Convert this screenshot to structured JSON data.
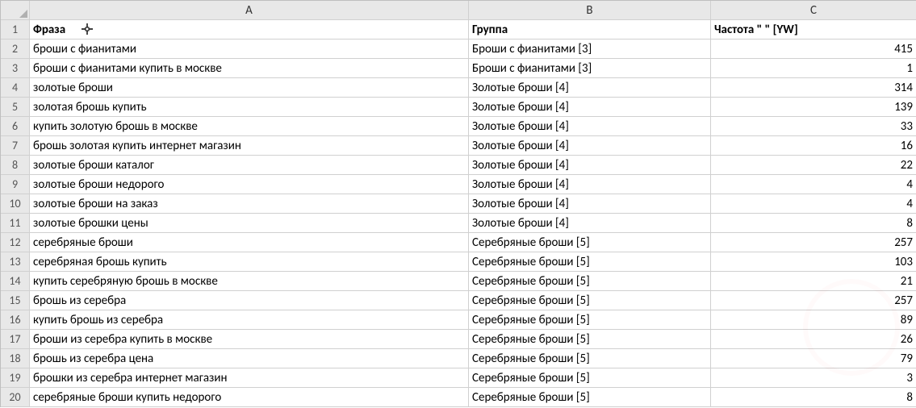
{
  "columns": [
    "A",
    "B",
    "C"
  ],
  "headers": {
    "phrase": "Фраза",
    "group": "Группа",
    "freq": "Частота \" \" [YW]"
  },
  "rows": [
    {
      "n": 2,
      "phrase": "броши с фианитами",
      "group": "Броши с фианитами [3]",
      "freq": 415
    },
    {
      "n": 3,
      "phrase": "броши с фианитами купить в москве",
      "group": "Броши с фианитами [3]",
      "freq": 1
    },
    {
      "n": 4,
      "phrase": "золотые броши",
      "group": "Золотые броши [4]",
      "freq": 314
    },
    {
      "n": 5,
      "phrase": "золотая брошь купить",
      "group": "Золотые броши [4]",
      "freq": 139
    },
    {
      "n": 6,
      "phrase": "купить золотую брошь в москве",
      "group": "Золотые броши [4]",
      "freq": 33
    },
    {
      "n": 7,
      "phrase": "брошь золотая купить интернет магазин",
      "group": "Золотые броши [4]",
      "freq": 16
    },
    {
      "n": 8,
      "phrase": "золотые броши каталог",
      "group": "Золотые броши [4]",
      "freq": 22
    },
    {
      "n": 9,
      "phrase": "золотые броши недорого",
      "group": "Золотые броши [4]",
      "freq": 4
    },
    {
      "n": 10,
      "phrase": "золотые броши на заказ",
      "group": "Золотые броши [4]",
      "freq": 4
    },
    {
      "n": 11,
      "phrase": "золотые брошки цены",
      "group": "Золотые броши [4]",
      "freq": 8
    },
    {
      "n": 12,
      "phrase": "серебряные броши",
      "group": "Серебряные броши [5]",
      "freq": 257
    },
    {
      "n": 13,
      "phrase": "серебряная брошь купить",
      "group": "Серебряные броши [5]",
      "freq": 103
    },
    {
      "n": 14,
      "phrase": "купить серебряную брошь в москве",
      "group": "Серебряные броши [5]",
      "freq": 21
    },
    {
      "n": 15,
      "phrase": "брошь из серебра",
      "group": "Серебряные броши [5]",
      "freq": 257
    },
    {
      "n": 16,
      "phrase": "купить брошь из серебра",
      "group": "Серебряные броши [5]",
      "freq": 89
    },
    {
      "n": 17,
      "phrase": "броши из серебра купить в москве",
      "group": "Серебряные броши [5]",
      "freq": 26
    },
    {
      "n": 18,
      "phrase": "брошь из серебра цена",
      "group": "Серебряные броши [5]",
      "freq": 79
    },
    {
      "n": 19,
      "phrase": "брошки из серебра интернет магазин",
      "group": "Серебряные броши [5]",
      "freq": 3
    },
    {
      "n": 20,
      "phrase": "серебряные броши купить недорого",
      "group": "Серебряные броши [5]",
      "freq": 8
    }
  ]
}
